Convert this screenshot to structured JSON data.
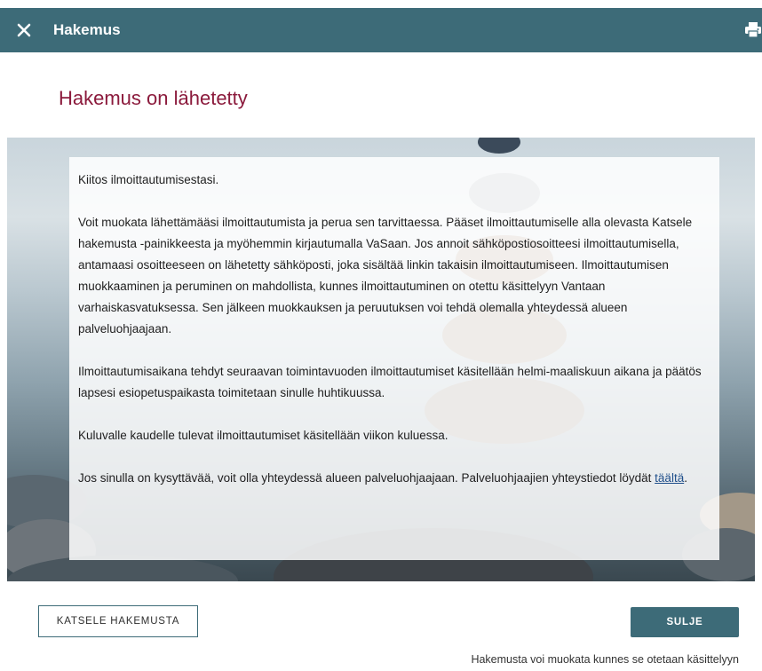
{
  "header": {
    "title": "Hakemus",
    "close_icon": "close-icon",
    "print_icon": "printer-icon",
    "background": "#3d6b78"
  },
  "page": {
    "heading": "Hakemus on lähetetty",
    "heading_color": "#8b1a3c"
  },
  "message": {
    "p1": "Kiitos ilmoittautumisestasi.",
    "p2": "Voit muokata lähettämääsi ilmoittautumista ja perua sen tarvittaessa. Pääset ilmoittautumiselle alla olevasta Katsele hakemusta -painikkeesta ja myöhemmin kirjautumalla VaSaan. Jos annoit sähköpostiosoitteesi ilmoittautumisella, antamaasi osoitteeseen on lähetetty sähköposti, joka sisältää linkin takaisin ilmoittautumiseen. Ilmoittautumisen muokkaaminen ja peruminen on mahdollista, kunnes ilmoittautuminen on otettu käsittelyyn Vantaan varhaiskasvatuksessa. Sen jälkeen muokkauksen ja peruutuksen voi tehdä olemalla yhteydessä alueen palveluohjaajaan.",
    "p3": "Ilmoittautumisaikana tehdyt seuraavan toimintavuoden ilmoittautumiset käsitellään helmi-maaliskuun aikana ja päätös lapsesi esiopetuspaikasta toimitetaan sinulle huhtikuussa.",
    "p4": "Kuluvalle kaudelle tulevat ilmoittautumiset käsitellään viikon kuluessa.",
    "p5_before": "Jos sinulla on kysyttävää, voit olla yhteydessä alueen palveluohjaajaan. Palveluohjaajien yhteystiedot löydät ",
    "p5_link": "täältä",
    "p5_after": "."
  },
  "actions": {
    "view_label": "KATSELE HAKEMUSTA",
    "close_label": "SULJE",
    "note": "Hakemusta voi muokata kunnes se otetaan käsittelyyn"
  }
}
